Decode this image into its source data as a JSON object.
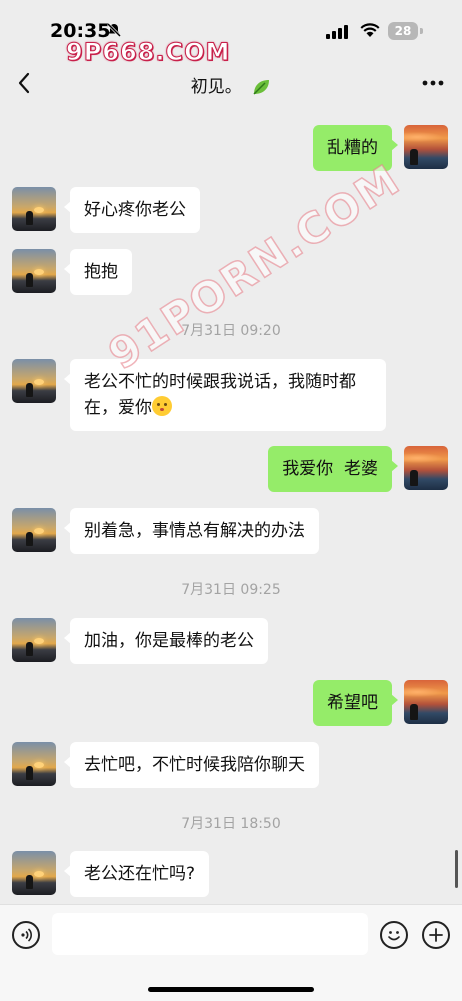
{
  "status_bar": {
    "time": "20:35",
    "battery": "28",
    "watermark": "9P668.COM"
  },
  "header": {
    "title": "初见。"
  },
  "watermark_diagonal": "91PORN.COM",
  "messages": [
    {
      "side": "right",
      "text": "乱糟的"
    },
    {
      "side": "left",
      "text": "好心疼你老公"
    },
    {
      "side": "left",
      "text": "抱抱"
    },
    {
      "type": "timestamp",
      "text": "7月31日 09:20"
    },
    {
      "side": "left",
      "text": "老公不忙的时候跟我说话，我随时都在，爱你"
    },
    {
      "side": "right",
      "text": "我爱你  老婆"
    },
    {
      "side": "left",
      "text": "别着急，事情总有解决的办法"
    },
    {
      "type": "timestamp",
      "text": "7月31日 09:25"
    },
    {
      "side": "left",
      "text": "加油，你是最棒的老公"
    },
    {
      "side": "right",
      "text": "希望吧"
    },
    {
      "side": "left",
      "text": "去忙吧，不忙时候我陪你聊天"
    },
    {
      "type": "timestamp",
      "text": "7月31日 18:50"
    },
    {
      "side": "left",
      "text": "老公还在忙吗?"
    }
  ],
  "input": {
    "value": ""
  },
  "icons": {
    "back": "chevron-left-icon",
    "more": "more-icon",
    "voice": "voice-icon",
    "emoji": "emoji-icon",
    "add": "plus-icon",
    "leaf": "leaf-icon"
  },
  "colors": {
    "background": "#ededed",
    "bubble_self": "#95ec69",
    "bubble_other": "#ffffff",
    "timestamp": "#a3a3a3"
  }
}
